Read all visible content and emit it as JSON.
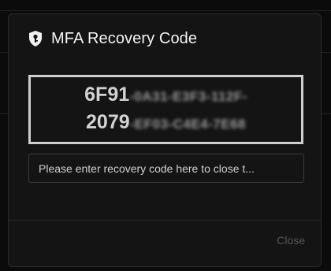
{
  "dialog": {
    "title": "MFA Recovery Code",
    "icon": "shield-key-icon"
  },
  "recovery_code": {
    "line1_visible": "6F91",
    "line1_masked": "-0A31-E3F3-112F-",
    "line2_visible": "2079",
    "line2_masked": "-EF03-C4E4-7E68"
  },
  "input": {
    "placeholder": "Please enter recovery code here to close t...",
    "value": ""
  },
  "footer": {
    "close_label": "Close"
  },
  "colors": {
    "background": "#0b0b0b",
    "modal": "#141414",
    "code_border": "#cfcfcf",
    "disabled_text": "#555555"
  }
}
